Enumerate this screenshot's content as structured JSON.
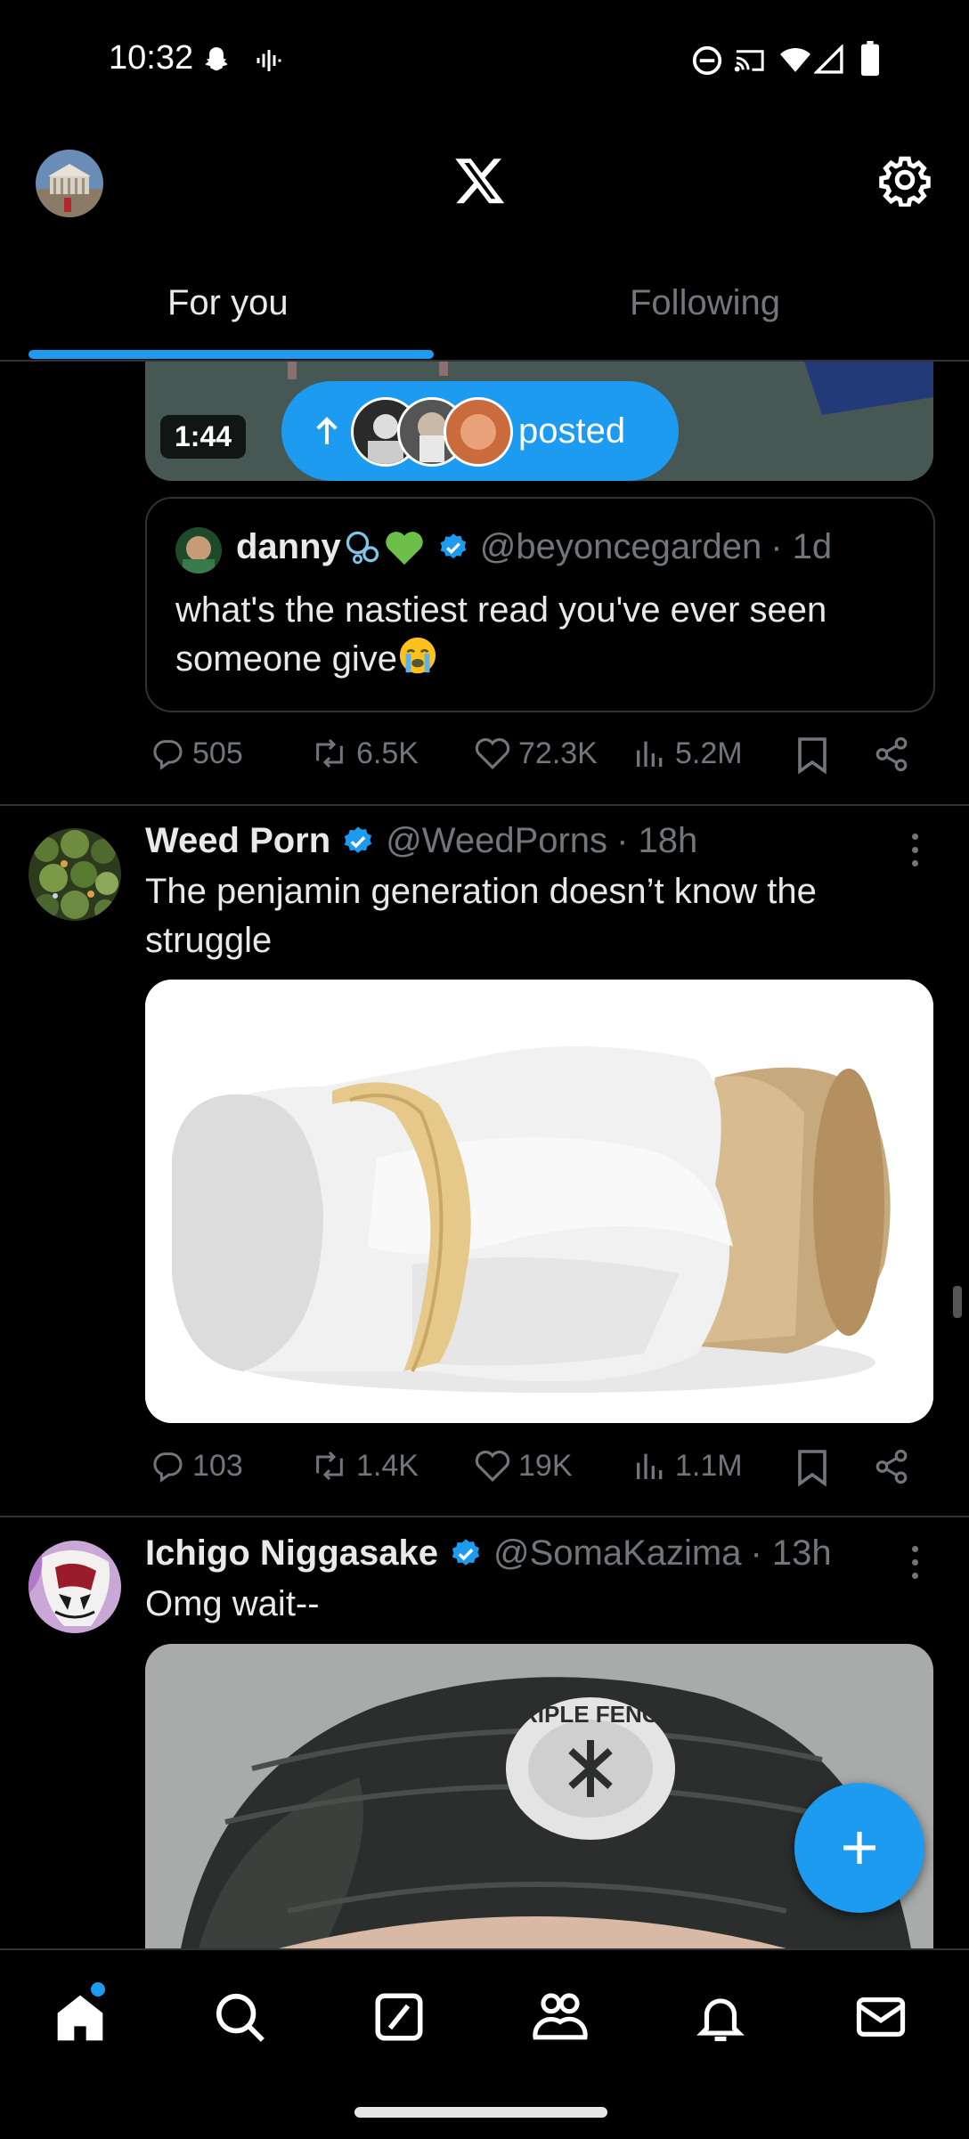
{
  "status_bar": {
    "time": "10:32",
    "icons": [
      "snapchat-icon",
      "voice-icon",
      "dnd-icon",
      "cast-icon",
      "wifi-icon",
      "signal-icon",
      "battery-icon"
    ]
  },
  "header": {
    "logo": "X",
    "tabs": [
      {
        "label": "For you",
        "active": true
      },
      {
        "label": "Following",
        "active": false
      }
    ]
  },
  "posted_pill": {
    "label": "posted"
  },
  "video": {
    "duration": "1:44"
  },
  "quote": {
    "name": "danny",
    "handle": "@beyoncegarden",
    "time": "· 1d",
    "text": "what's the nastiest read you've ever seen someone give"
  },
  "tweets": [
    {
      "actions": {
        "replies": "505",
        "reposts": "6.5K",
        "likes": "72.3K",
        "views": "5.2M"
      }
    },
    {
      "name": "Weed Porn",
      "handle": "@WeedPorns",
      "time": "· 18h",
      "text": "The penjamin generation doesn’t know the struggle",
      "actions": {
        "replies": "103",
        "reposts": "1.4K",
        "likes": "19K",
        "views": "1.1M"
      }
    },
    {
      "name": "Ichigo Niggasake",
      "handle": "@SomaKazima",
      "time": "· 13h",
      "text": "Omg wait--",
      "image_text": "TRIPLE FENCE"
    }
  ],
  "nav": [
    "home-icon",
    "search-icon",
    "grok-icon",
    "communities-icon",
    "notifications-icon",
    "messages-icon"
  ],
  "colors": {
    "accent": "#1d9bf0",
    "bg": "#000000",
    "secondary_text": "#71767b"
  }
}
